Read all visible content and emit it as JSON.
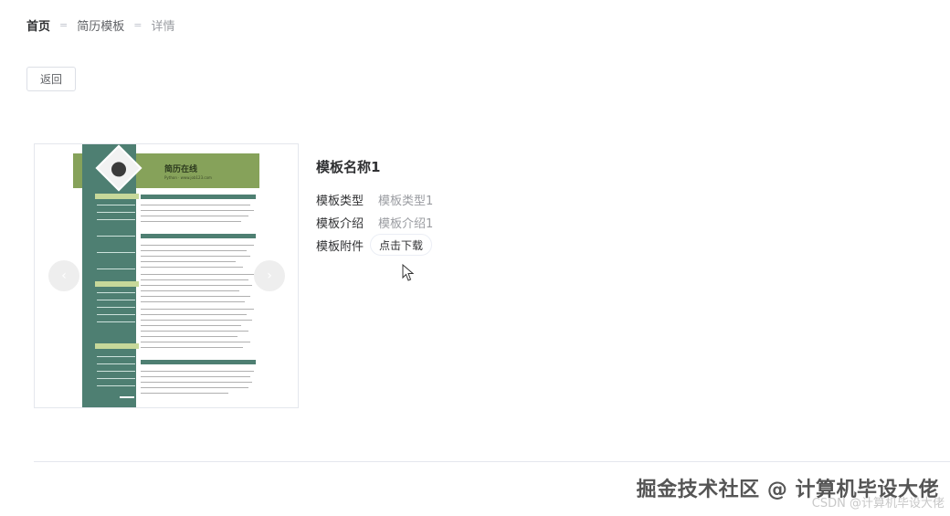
{
  "breadcrumb": {
    "home": "首页",
    "category": "简历模板",
    "current": "详情",
    "separator": "="
  },
  "back_button": "返回",
  "carousel": {
    "prev_icon": "‹",
    "next_icon": "›",
    "resume_preview": {
      "title": "简历在线",
      "subtitle": "Python · www.job123.com"
    }
  },
  "template": {
    "name": "模板名称1",
    "type_label": "模板类型",
    "type_value": "模板类型1",
    "desc_label": "模板介绍",
    "desc_value": "模板介绍1",
    "attachment_label": "模板附件",
    "download_button": "点击下载"
  },
  "watermark": {
    "main": "掘金技术社区 @ 计算机毕设大佬",
    "csdn": "CSDN @计算机毕设大佬"
  },
  "colors": {
    "accent_green": "#86a25a",
    "teal": "#4e7f72"
  }
}
